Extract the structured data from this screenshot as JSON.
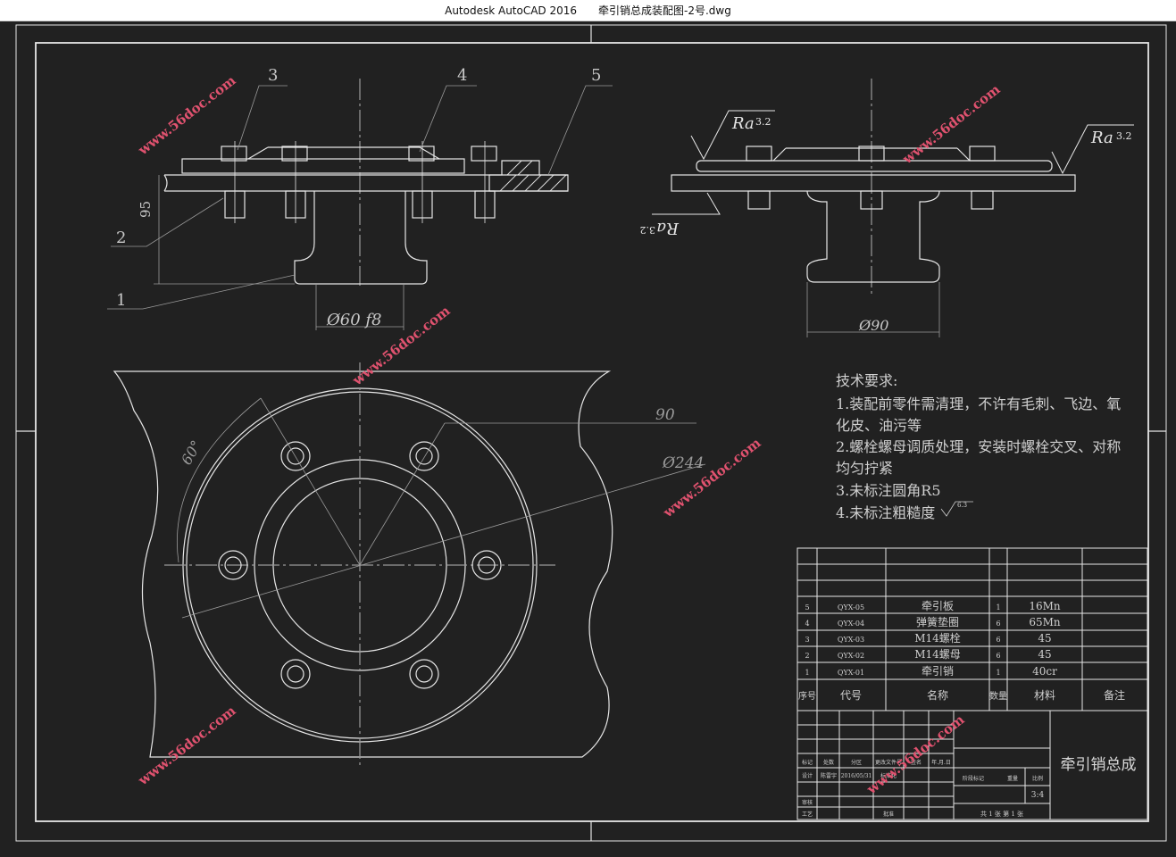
{
  "window": {
    "app": "Autodesk AutoCAD 2016",
    "file": "牵引销总成装配图-2号.dwg"
  },
  "watermark": "www.56doc.com",
  "colors": {
    "background": "#212121",
    "line": "#e6e6e6",
    "dim": "#9a9a9a",
    "watermark": "#e0526f"
  },
  "balloons": [
    "3",
    "4",
    "5",
    "2",
    "1"
  ],
  "dimensions": {
    "height": "95",
    "shaft_dia": "Ø60 f8",
    "flange_dia": "Ø90",
    "bolt_circle": "90",
    "outer_dia": "Ø244",
    "angle": "60°"
  },
  "roughness": {
    "symbol": "Ra",
    "value": "3.2"
  },
  "tech_requirements": {
    "title": "技术要求:",
    "lines": [
      "1.装配前零件需清理，不许有毛刺、飞边、氧",
      "化皮、油污等",
      "2.螺栓螺母调质处理，安装时螺栓交叉、对称",
      "均匀拧紧",
      "3.未标注圆角R5",
      "4.未标注粗糙度"
    ],
    "rough_mark": "6.3"
  },
  "bom": {
    "rows": [
      {
        "no": "5",
        "code": "QYX-05",
        "name": "牵引板",
        "qty": "1",
        "material": "16Mn"
      },
      {
        "no": "4",
        "code": "QYX-04",
        "name": "弹簧垫圈",
        "qty": "6",
        "material": "65Mn"
      },
      {
        "no": "3",
        "code": "QYX-03",
        "name": "M14螺栓",
        "qty": "6",
        "material": "45"
      },
      {
        "no": "2",
        "code": "QYX-02",
        "name": "M14螺母",
        "qty": "6",
        "material": "45"
      },
      {
        "no": "1",
        "code": "QYX-01",
        "name": "牵引销",
        "qty": "1",
        "material": "40cr"
      }
    ],
    "header": {
      "no": "序号",
      "code": "代号",
      "name": "名称",
      "qty": "数量",
      "material": "材料",
      "note": "备注"
    }
  },
  "title_block": {
    "drawing_name": "牵引销总成",
    "scale": "3:4",
    "sheet": "共 1 张   第 1 张",
    "labels": [
      "标记",
      "处数",
      "分区",
      "更改文件号",
      "签名",
      "年.月.日",
      "设计",
      "标准化",
      "阶段标记",
      "重量",
      "比例",
      "审核",
      "工艺",
      "批准"
    ],
    "designer": "陈雷宇",
    "date": "2016/05/31"
  }
}
